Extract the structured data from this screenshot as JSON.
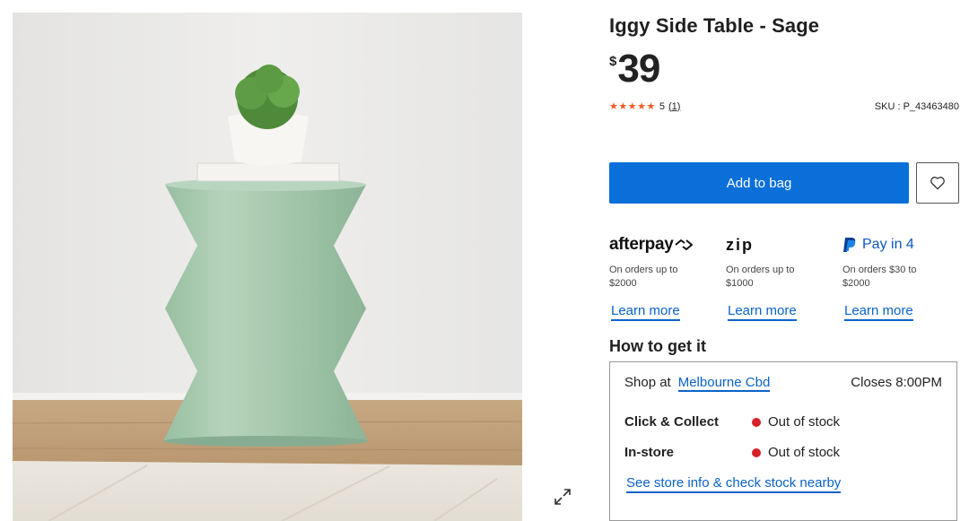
{
  "product": {
    "title": "Iggy Side Table - Sage",
    "currency": "$",
    "price": "39",
    "stars": "★★★★★",
    "rating": "5",
    "review_count": "(1)",
    "sku": "SKU : P_43463480"
  },
  "actions": {
    "add_to_bag": "Add to bag"
  },
  "payments": [
    {
      "logo": "afterpay",
      "note": "On orders up to $2000",
      "link": "Learn more"
    },
    {
      "logo": "zip",
      "note": "On orders up to $1000",
      "link": "Learn more"
    },
    {
      "logo": "Pay in 4",
      "note": "On orders $30 to $2000",
      "link": "Learn more"
    }
  ],
  "fulfilment": {
    "heading": "How to get it",
    "shop_at": "Shop at",
    "store": "Melbourne Cbd",
    "hours": "Closes 8:00PM",
    "rows": [
      {
        "label": "Click & Collect",
        "status": "Out of stock"
      },
      {
        "label": "In-store",
        "status": "Out of stock"
      }
    ],
    "store_info_link": "See store info & check stock nearby"
  },
  "colors": {
    "primary": "#0a6fd9",
    "link": "#0a63c9",
    "star": "#ee5a24",
    "out_of_stock": "#d6202a",
    "table": "#a9c8ad"
  },
  "icons": [
    "heart-icon",
    "expand-icon",
    "paypal-icon",
    "afterpay-icon",
    "status-dot"
  ]
}
